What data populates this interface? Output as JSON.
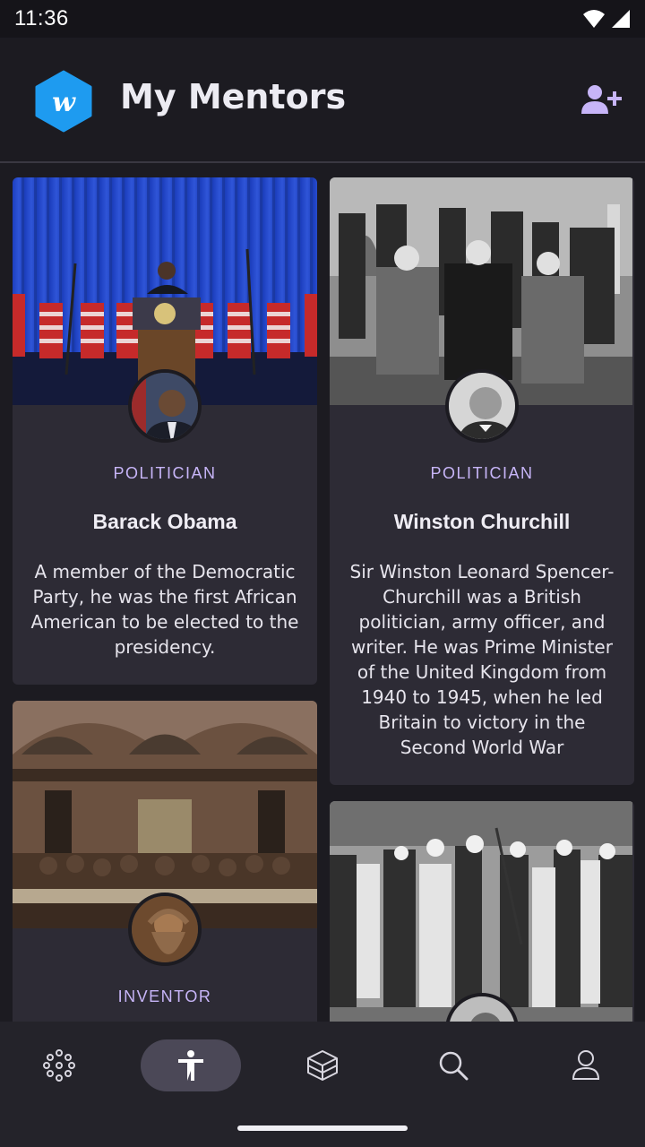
{
  "status_bar": {
    "time": "11:36",
    "wifi_icon": "wifi-icon",
    "signal_icon": "cell-signal-icon"
  },
  "header": {
    "title": "My Mentors",
    "logo_icon": "app-logo-hexagon",
    "add_icon": "add-user-icon"
  },
  "colors": {
    "accent": "#c7b5f8",
    "card_bg": "#2d2b35",
    "page_bg": "#1c1b21",
    "logo_blue": "#1e9bf0"
  },
  "mentors": [
    {
      "category": "POLITICIAN",
      "name": "Barack Obama",
      "description": "A member of the Democratic Party, he was the first African American to be elected to the presidency."
    },
    {
      "category": "POLITICIAN",
      "name": "Winston Churchill",
      "description": "Sir Winston Leonard Spencer-Churchill was a British politician, army officer, and writer. He was Prime Minister of the United Kingdom from 1940 to 1945, when he led Britain to victory in the Second World War"
    },
    {
      "category": "INVENTOR",
      "name": "",
      "description": ""
    },
    {
      "category": "",
      "name": "",
      "description": ""
    }
  ],
  "bottom_nav": [
    {
      "icon": "network-dots-icon",
      "active": false
    },
    {
      "icon": "person-accessibility-icon",
      "active": true
    },
    {
      "icon": "box-icon",
      "active": false
    },
    {
      "icon": "search-icon",
      "active": false
    },
    {
      "icon": "profile-icon",
      "active": false
    }
  ]
}
